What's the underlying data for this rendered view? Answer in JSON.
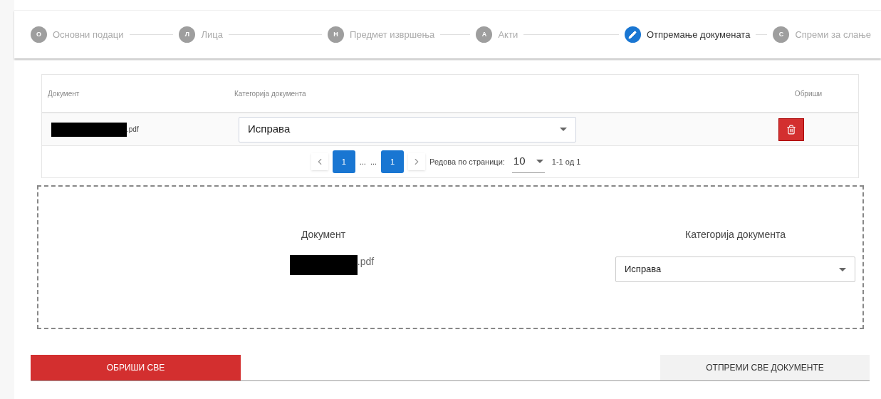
{
  "stepper": [
    {
      "kind": "letter",
      "badge": "О",
      "label": "Основни подаци",
      "selected": false
    },
    {
      "kind": "letter",
      "badge": "Л",
      "label": "Лица",
      "selected": false
    },
    {
      "kind": "letter",
      "badge": "Н",
      "label": "Предмет извршења",
      "selected": false
    },
    {
      "kind": "letter",
      "badge": "А",
      "label": "Акти",
      "selected": false
    },
    {
      "kind": "edit",
      "label": "Отпремање докумената",
      "selected": true
    },
    {
      "kind": "letter",
      "badge": "С",
      "label": "Спреми за слање",
      "selected": false
    }
  ],
  "table": {
    "columns": [
      "Документ",
      "Категорија документа",
      "Обриши"
    ],
    "rows": [
      {
        "file": ".pdf",
        "category": "Исправа"
      }
    ],
    "pagination": {
      "pages": [
        {
          "label": "1",
          "selected": true
        },
        {
          "label": "1",
          "selected": true
        }
      ],
      "ellipsis": [
        "...",
        "..."
      ],
      "rows_label": "Редова по страници:",
      "rows_per_page": "10",
      "range": "1-1 од 1"
    }
  },
  "upload_area": {
    "document_label": "Документ",
    "file": ".pdf",
    "category_label": "Категорија документа",
    "category": "Исправа"
  },
  "buttons": [
    {
      "kind": "danger",
      "label": "ОБРИШИ СВЕ"
    },
    {
      "kind": "default",
      "label": "ОТПРЕМИ СВЕ ДОКУМЕНТЕ"
    }
  ]
}
